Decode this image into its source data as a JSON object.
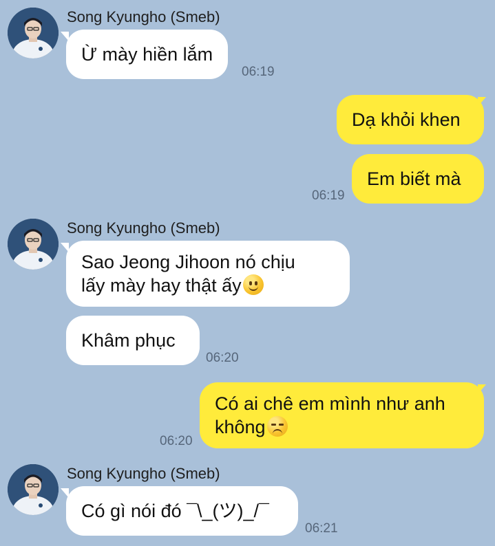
{
  "colors": {
    "background": "#a9c0d9",
    "incoming_bubble": "#ffffff",
    "outgoing_bubble": "#ffeb3b",
    "timestamp": "#56667a"
  },
  "messages": {
    "group1": {
      "sender": "Song Kyungho (Smeb)",
      "bubble1": "Ừ mày hiền lắm",
      "time": "06:19"
    },
    "group2": {
      "bubble1": "Dạ khỏi khen",
      "bubble2": "Em biết mà",
      "time": "06:19"
    },
    "group3": {
      "sender": "Song Kyungho (Smeb)",
      "bubble1_line1": "Sao Jeong Jihoon nó chịu",
      "bubble1_line2": "lấy mày hay thật ấy",
      "bubble1_emoji": "slightly-smiling-face",
      "bubble2": "Khâm phục",
      "time": "06:20"
    },
    "group4": {
      "bubble1_line1": "Có ai chê em mình như anh",
      "bubble1_line2": "không",
      "bubble1_emoji": "unamused-face",
      "time": "06:20"
    },
    "group5": {
      "sender": "Song Kyungho (Smeb)",
      "bubble1": "Có gì nói đó ¯\\_(ツ)_/¯",
      "time": "06:21"
    }
  }
}
